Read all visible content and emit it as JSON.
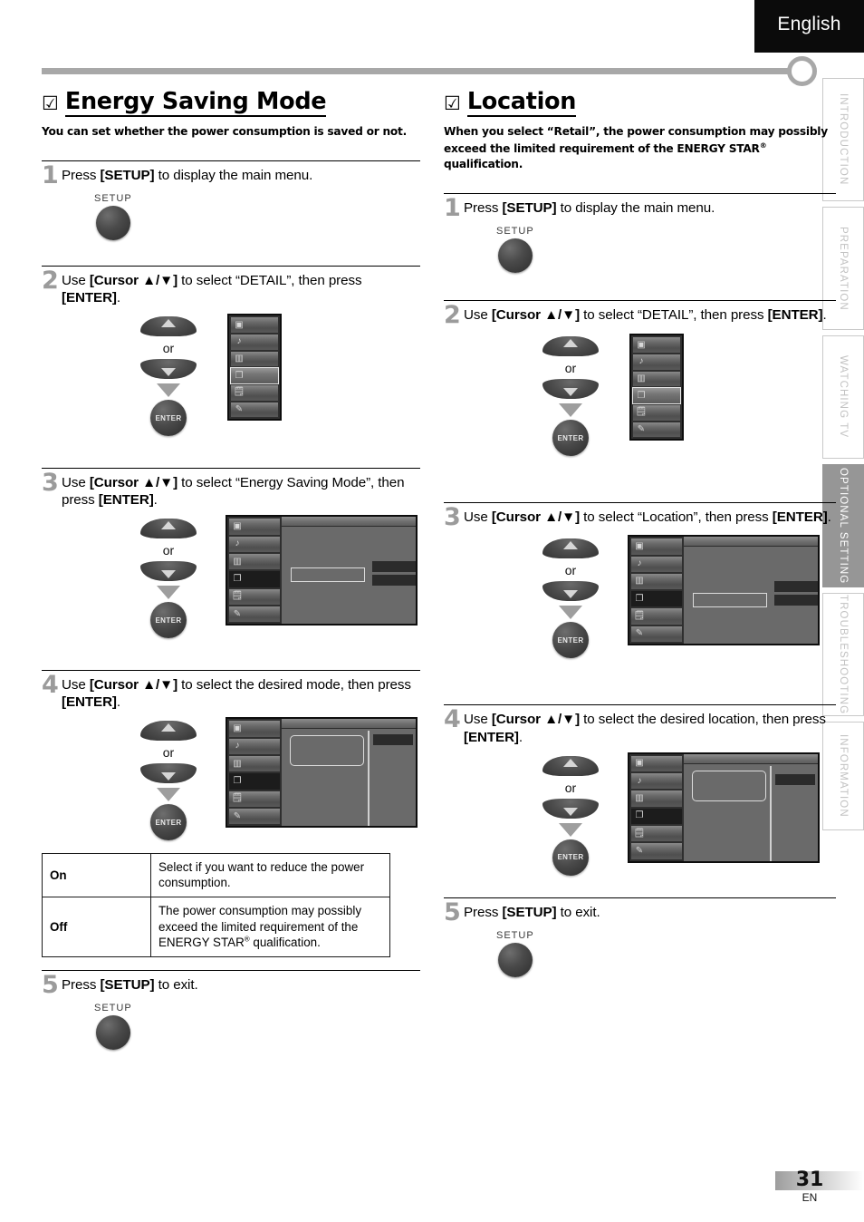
{
  "language_badge": "English",
  "side_tabs": [
    {
      "label": "INTRODUCTION",
      "active": false
    },
    {
      "label": "PREPARATION",
      "active": false
    },
    {
      "label": "WATCHING  TV",
      "active": false
    },
    {
      "label": "OPTIONAL  SETTING",
      "active": true
    },
    {
      "label": "TROUBLESHOOTING",
      "active": false
    },
    {
      "label": "INFORMATION",
      "active": false
    }
  ],
  "left_section": {
    "checkbox": "☑",
    "title": "Energy Saving Mode",
    "description": "You can set whether the power consumption is saved or not.",
    "steps": [
      {
        "num": "1",
        "text_html": "Press <b>[SETUP]</b> to display the main menu.",
        "button_label": "SETUP"
      },
      {
        "num": "2",
        "text_html": "Use <b>[Cursor ▲/▼]</b> to select “DETAIL”, then press <b>[ENTER]</b>.",
        "or_label": "or",
        "enter_label": "ENTER"
      },
      {
        "num": "3",
        "text_html": "Use <b>[Cursor ▲/▼]</b> to select “Energy Saving Mode”, then press <b>[ENTER]</b>.",
        "or_label": "or",
        "enter_label": "ENTER"
      },
      {
        "num": "4",
        "text_html": "Use <b>[Cursor ▲/▼]</b> to select the desired mode, then press <b>[ENTER]</b>.",
        "or_label": "or",
        "enter_label": "ENTER"
      },
      {
        "num": "5",
        "text_html": "Press <b>[SETUP]</b> to exit.",
        "button_label": "SETUP"
      }
    ],
    "value_table": {
      "rows": [
        {
          "key": "On",
          "desc": "Select if you want to reduce the power consumption."
        },
        {
          "key": "Off",
          "desc": "The power consumption may possibly exceed the limited requirement of the ENERGY STAR® qualification."
        }
      ]
    }
  },
  "right_section": {
    "checkbox": "☑",
    "title": "Location",
    "description": "When you select “Retail”, the power consumption may possibly exceed the limited requirement of the ENERGY STAR® qualification.",
    "steps": [
      {
        "num": "1",
        "text_html": "Press <b>[SETUP]</b> to display the main menu.",
        "button_label": "SETUP"
      },
      {
        "num": "2",
        "text_html": "Use <b>[Cursor ▲/▼]</b> to select “DETAIL”, then press <b>[ENTER]</b>.",
        "or_label": "or",
        "enter_label": "ENTER"
      },
      {
        "num": "3",
        "text_html": "Use <b>[Cursor ▲/▼]</b> to select “Location”, then press <b>[ENTER]</b>.",
        "or_label": "or",
        "enter_label": "ENTER"
      },
      {
        "num": "4",
        "text_html": "Use <b>[Cursor ▲/▼]</b> to select the desired location, then press <b>[ENTER]</b>.",
        "or_label": "or",
        "enter_label": "ENTER"
      },
      {
        "num": "5",
        "text_html": "Press <b>[SETUP]</b> to exit.",
        "button_label": "SETUP"
      }
    ]
  },
  "osd_menu": {
    "rows": [
      "picture-icon",
      "sound-icon",
      "lock-icon",
      "detail-icon",
      "channel-icon",
      "setup-pencil-icon"
    ],
    "selected_index": 3
  },
  "footer": {
    "page_number": "31",
    "page_suffix": "EN"
  },
  "colors": {
    "accent_gray": "#a8a8a8",
    "tab_active": "#969696",
    "tab_text": "#c2c2c2",
    "badge_bg": "#0b0b0b",
    "step_num": "#9b9b9b",
    "osd_bg": "#3a3a3a"
  }
}
